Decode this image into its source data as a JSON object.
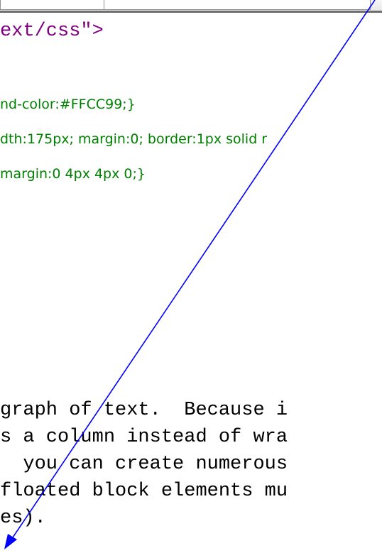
{
  "editor": {
    "lines": {
      "style_tag": "ext/css\">",
      "css_1": "nd-color:#FFCC99;}",
      "css_2": "dth:175px; margin:0; border:1px solid r",
      "css_3": "margin:0 4px 4px 0;}",
      "para_1": "graph of text.  Because i",
      "para_2": "s a column instead of wra",
      "para_3": "  you can create numerous",
      "para_4": "floated block elements mu",
      "para_5": "es)."
    }
  },
  "annotation": {
    "arrow_color": "#0000ff"
  }
}
